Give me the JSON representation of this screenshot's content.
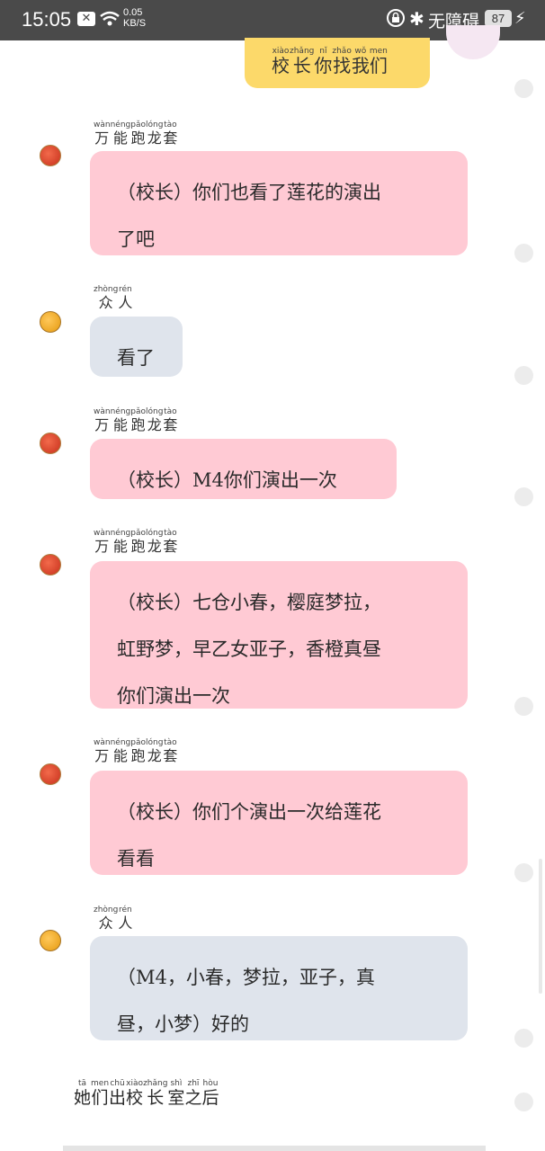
{
  "status_bar": {
    "time": "15:05",
    "net_speed_value": "0.05",
    "net_speed_unit": "KB/S",
    "accessibility": "无障碍",
    "battery": "87"
  },
  "top_message": {
    "text": "校长你找我们",
    "pinyin": [
      "xiào",
      "zhǎng",
      "nǐ",
      "zhǎo",
      "wǒ",
      "men"
    ]
  },
  "messages": [
    {
      "sender": "万能跑龙套",
      "sender_pinyin": [
        "wàn",
        "néng",
        "pǎo",
        "lóng",
        "tào"
      ],
      "lines": [
        "（校长）你们也看了莲花的演出",
        "了吧"
      ]
    },
    {
      "sender": "众人",
      "sender_pinyin": [
        "zhòng",
        "rén"
      ],
      "lines": [
        "看了"
      ]
    },
    {
      "sender": "万能跑龙套",
      "sender_pinyin": [
        "wàn",
        "néng",
        "pǎo",
        "lóng",
        "tào"
      ],
      "lines": [
        "（校长）M4你们演出一次"
      ]
    },
    {
      "sender": "万能跑龙套",
      "sender_pinyin": [
        "wàn",
        "néng",
        "pǎo",
        "lóng",
        "tào"
      ],
      "lines": [
        "（校长）七仓小春，樱庭梦拉，",
        "虹野梦，早乙女亚子，香橙真昼",
        "你们演出一次"
      ]
    },
    {
      "sender": "万能跑龙套",
      "sender_pinyin": [
        "wàn",
        "néng",
        "pǎo",
        "lóng",
        "tào"
      ],
      "lines": [
        "（校长）你们个演出一次给莲花",
        "看看"
      ]
    },
    {
      "sender": "众人",
      "sender_pinyin": [
        "zhòng",
        "rén"
      ],
      "lines": [
        "（M4，小春，梦拉，亚子，真",
        "昼，小梦）好的"
      ]
    }
  ],
  "narration": {
    "text": "她们出校长室之后",
    "pinyin": [
      "tā",
      "men",
      "chū",
      "xiào",
      "zhǎng",
      "shì",
      "zhī",
      "hòu"
    ]
  },
  "colors": {
    "status_bar": "#4a4a4a",
    "top_bubble": "#fcd96a",
    "pink_bubble": "#ffcad4",
    "gray_bubble": "#dfe4ec"
  }
}
